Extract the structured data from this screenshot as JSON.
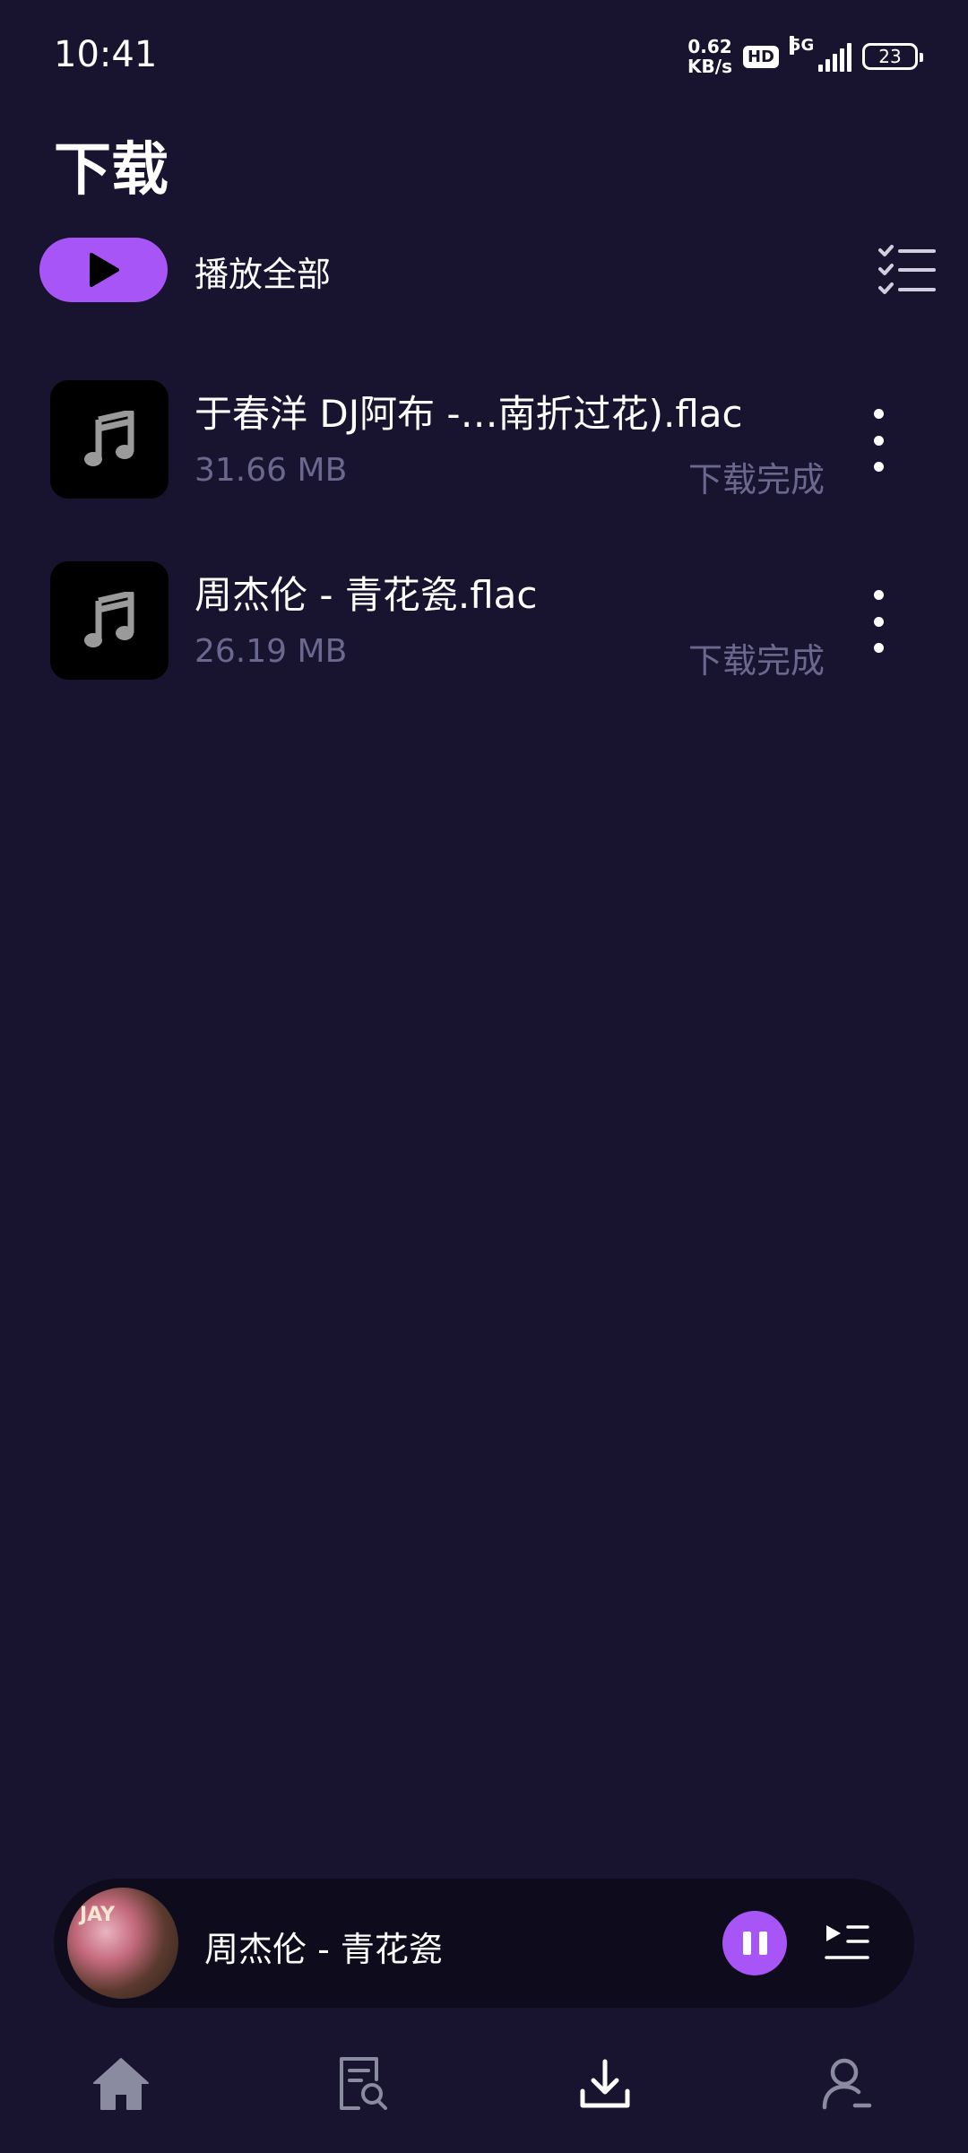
{
  "status_bar": {
    "time": "10:41",
    "net_speed_value": "0.62",
    "net_speed_unit": "KB/s",
    "hd_badge": "HD",
    "network_type": "5G",
    "battery": "23"
  },
  "header": {
    "title": "下载",
    "play_all_label": "播放全部",
    "icons": {
      "play": "play-icon",
      "multi_select": "checklist-icon"
    }
  },
  "downloads": [
    {
      "name": "于春洋 DJ阿布 -…南折过花).flac",
      "size": "31.66 MB",
      "status": "下载完成",
      "icon": "music-note-icon"
    },
    {
      "name": "周杰伦 - 青花瓷.flac",
      "size": "26.19 MB",
      "status": "下载完成",
      "icon": "music-note-icon"
    }
  ],
  "player": {
    "title": "周杰伦 - 青花瓷",
    "cover_mark": "JAY",
    "icons": {
      "pause": "pause-icon",
      "queue": "playlist-icon"
    }
  },
  "bottom_nav": {
    "active": "download",
    "items": [
      "home-icon",
      "search-doc-icon",
      "download-icon",
      "user-icon"
    ]
  },
  "colors": {
    "background": "#18142f",
    "accent": "#a855f7",
    "muted_text": "#6b6890",
    "player_bg": "#0e0b1c"
  }
}
